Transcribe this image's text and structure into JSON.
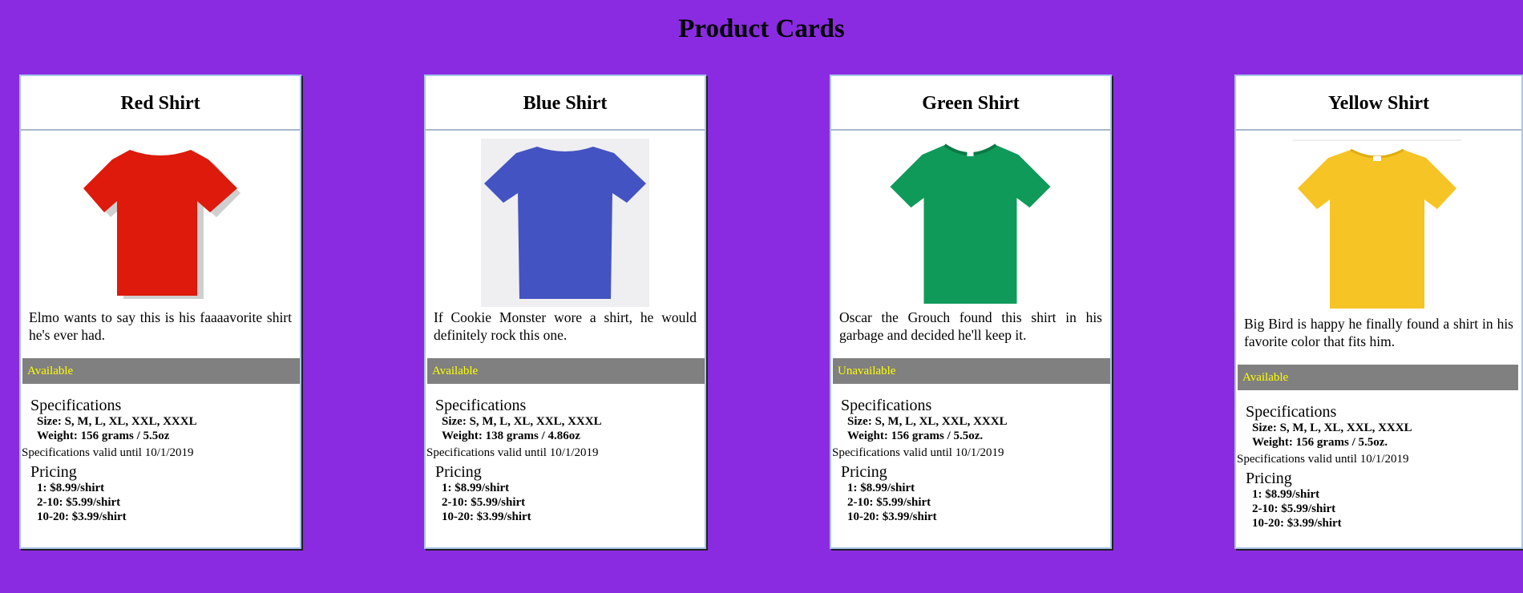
{
  "page": {
    "title": "Product Cards"
  },
  "cards": [
    {
      "name": "Red Shirt",
      "color": "#dd1a0c",
      "description": "Elmo wants to say this is his faaaavorite shirt he's ever had.",
      "status": "Available",
      "specs_heading": "Specifications",
      "size": "Size: S, M, L, XL, XXL, XXXL",
      "weight": "Weight: 156 grams / 5.5oz",
      "valid": "Specifications valid until 10/1/2019",
      "pricing_heading": "Pricing",
      "prices": [
        "1: $8.99/shirt",
        "2-10: $5.99/shirt",
        "10-20: $3.99/shirt"
      ]
    },
    {
      "name": "Blue Shirt",
      "color": "#4453c2",
      "description": "If Cookie Monster wore a shirt, he would definitely rock this one.",
      "status": "Available",
      "specs_heading": "Specifications",
      "size": "Size: S, M, L, XL, XXL, XXXL",
      "weight": "Weight: 138 grams / 4.86oz",
      "valid": "Specifications valid until 10/1/2019",
      "pricing_heading": "Pricing",
      "prices": [
        "1: $8.99/shirt",
        "2-10: $5.99/shirt",
        "10-20: $3.99/shirt"
      ]
    },
    {
      "name": "Green Shirt",
      "color": "#109a5a",
      "description": "Oscar the Grouch found this shirt in his garbage and decided he'll keep it.",
      "status": "Unavailable",
      "specs_heading": "Specifications",
      "size": "Size: S, M, L, XL, XXL, XXXL",
      "weight": "Weight: 156 grams / 5.5oz.",
      "valid": "Specifications valid until 10/1/2019",
      "pricing_heading": "Pricing",
      "prices": [
        "1: $8.99/shirt",
        "2-10: $5.99/shirt",
        "10-20: $3.99/shirt"
      ]
    },
    {
      "name": "Yellow Shirt",
      "color": "#f6c425",
      "description": "Big Bird is happy he finally found a shirt in his favorite color that fits him.",
      "status": "Available",
      "specs_heading": "Specifications",
      "size": "Size: S, M, L, XL, XXL, XXXL",
      "weight": "Weight: 156 grams / 5.5oz.",
      "valid": "Specifications valid until 10/1/2019",
      "pricing_heading": "Pricing",
      "prices": [
        "1: $8.99/shirt",
        "2-10: $5.99/shirt",
        "10-20: $3.99/shirt"
      ]
    }
  ]
}
